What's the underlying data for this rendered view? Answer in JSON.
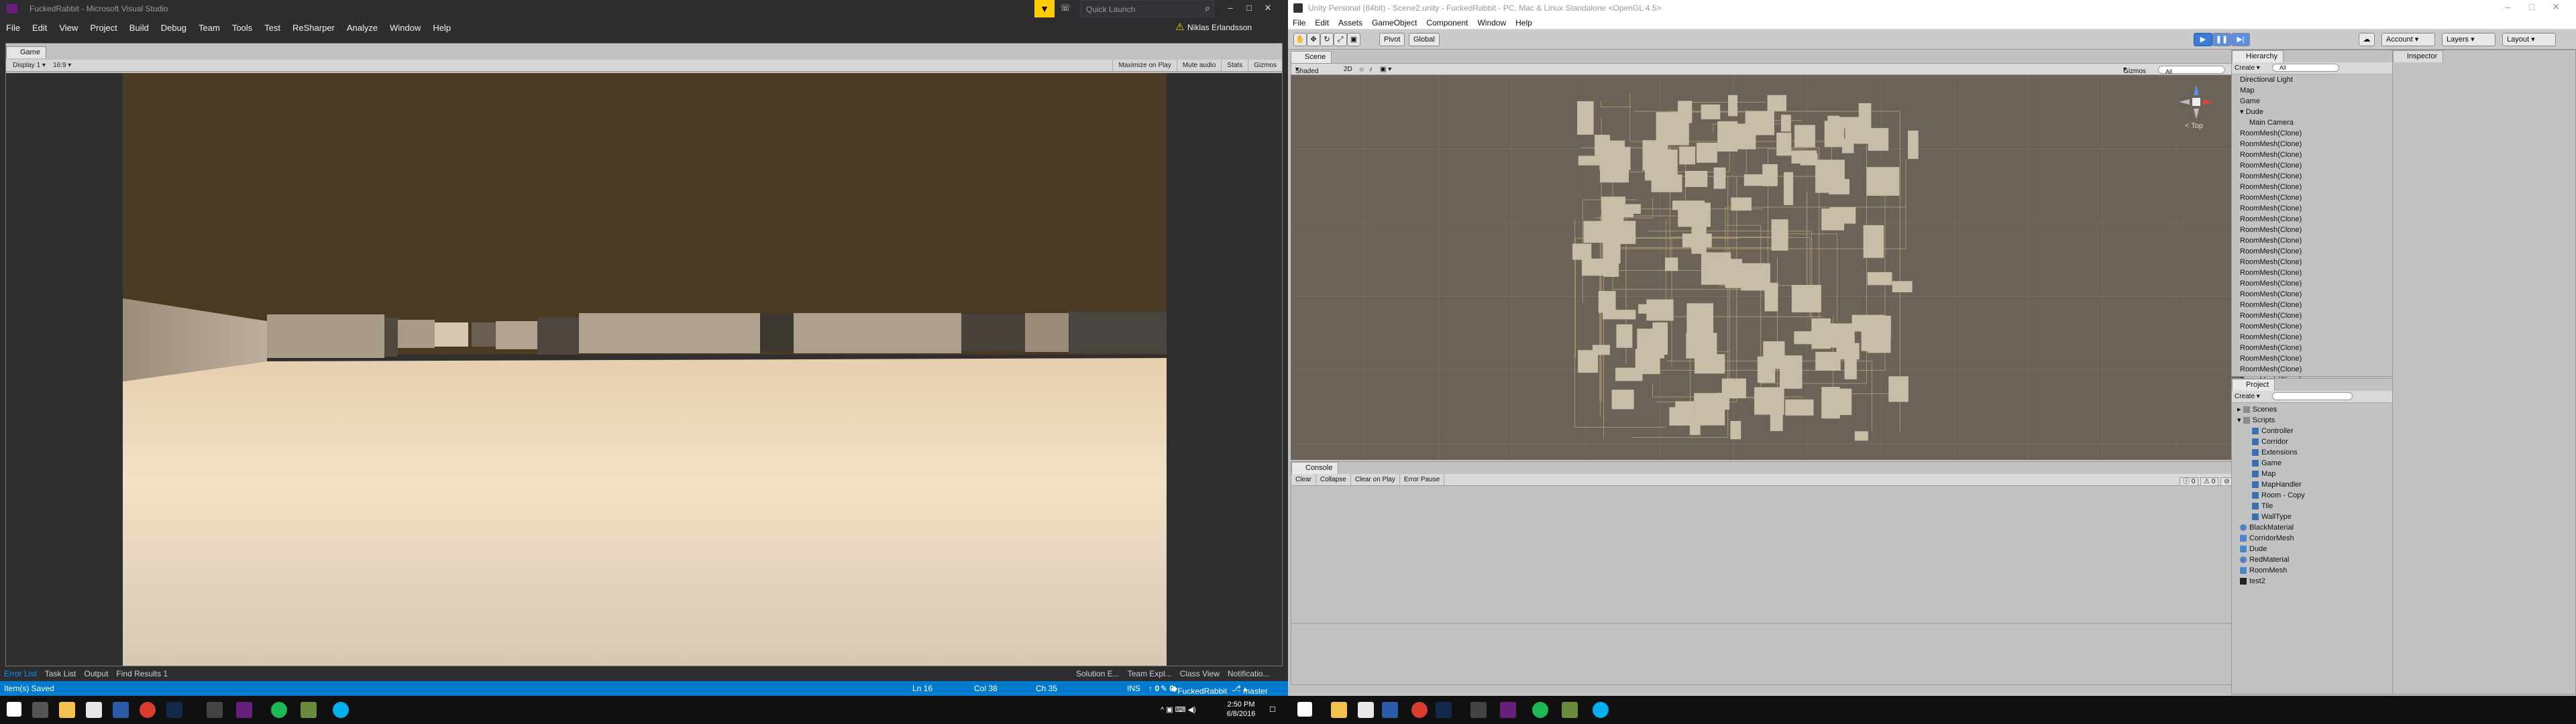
{
  "vs": {
    "title": "FuckedRabbit - Microsoft Visual Studio",
    "menu": [
      "File",
      "Edit",
      "View",
      "Project",
      "Build",
      "Debug",
      "Team",
      "Tools",
      "Test",
      "ReSharper",
      "Analyze",
      "Window",
      "Help"
    ],
    "quick_launch_placeholder": "Quick Launch",
    "user": "Niklas Erlandsson",
    "bottom_tabs": [
      "Error List",
      "Task List",
      "Output",
      "Find Results 1"
    ],
    "right_tabs": [
      "Solution E...",
      "Team Expl...",
      "Class View",
      "Notificatio..."
    ],
    "status": {
      "message": "Item(s) Saved",
      "ln": "Ln 16",
      "col": "Col 38",
      "ch": "Ch 35",
      "mode": "INS",
      "up": "0",
      "pencil": "0",
      "repo": "FuckedRabbit",
      "branch": "master"
    }
  },
  "game": {
    "tab": "Game",
    "display": "Display 1",
    "aspect": "16:9",
    "toolbar_right": [
      "Maximize on Play",
      "Mute audio",
      "Stats",
      "Gizmos"
    ]
  },
  "unity": {
    "title": "Unity Personal (64bit) - Scene2.unity - FuckedRabbit - PC, Mac & Linux Standalone <OpenGL 4.5>",
    "menu": [
      "File",
      "Edit",
      "Assets",
      "GameObject",
      "Component",
      "Window",
      "Help"
    ],
    "toolbar": {
      "pivot": "Pivot",
      "global": "Global",
      "account": "Account",
      "layers": "Layers",
      "layout": "Layout"
    },
    "scene": {
      "tab": "Scene",
      "shading": "Shaded",
      "mode2d": "2D",
      "gizmos": "Gizmos",
      "search_placeholder": "All",
      "persp": "< Top"
    },
    "console": {
      "tab": "Console",
      "buttons": [
        "Clear",
        "Collapse",
        "Clear on Play",
        "Error Pause"
      ],
      "counts": [
        "0",
        "0",
        "0"
      ]
    },
    "hierarchy": {
      "tab": "Hierarchy",
      "create": "Create",
      "search_placeholder": "All",
      "items": [
        "Directional Light",
        "Map",
        "Game",
        "Dude",
        "Main Camera",
        "RoomMesh(Clone)",
        "RoomMesh(Clone)",
        "RoomMesh(Clone)",
        "RoomMesh(Clone)",
        "RoomMesh(Clone)",
        "RoomMesh(Clone)",
        "RoomMesh(Clone)",
        "RoomMesh(Clone)",
        "RoomMesh(Clone)",
        "RoomMesh(Clone)",
        "RoomMesh(Clone)",
        "RoomMesh(Clone)",
        "RoomMesh(Clone)",
        "RoomMesh(Clone)",
        "RoomMesh(Clone)",
        "RoomMesh(Clone)",
        "RoomMesh(Clone)",
        "RoomMesh(Clone)",
        "RoomMesh(Clone)",
        "RoomMesh(Clone)",
        "RoomMesh(Clone)",
        "RoomMesh(Clone)",
        "RoomMesh(Clone)",
        "RoomMesh(Clone)",
        "RoomMesh(Clone)"
      ]
    },
    "project": {
      "tab": "Project",
      "create": "Create",
      "items": [
        "Scenes",
        "Scripts",
        "Controller",
        "Corridor",
        "Extensions",
        "Game",
        "Map",
        "MapHandler",
        "Room - Copy",
        "Tile",
        "WallType",
        "BlackMaterial",
        "CorridorMesh",
        "Dude",
        "RedMaterial",
        "RoomMesh",
        "test2"
      ]
    },
    "inspector": {
      "tab": "Inspector"
    }
  },
  "taskbar": {
    "time": "2:50 PM",
    "date": "6/8/2016"
  },
  "colors": {
    "vs_status": "#007acc",
    "unity_play": "#3d7bd9",
    "game_ceiling": "#4a3a22",
    "game_floor": "#f0dcc0",
    "scene_bg": "#6b6258",
    "room_fill": "#c8bea8"
  },
  "icons": {
    "filter": "filter-icon",
    "search": "search-icon",
    "warning": "warning-icon",
    "start": "windows-start-icon"
  }
}
